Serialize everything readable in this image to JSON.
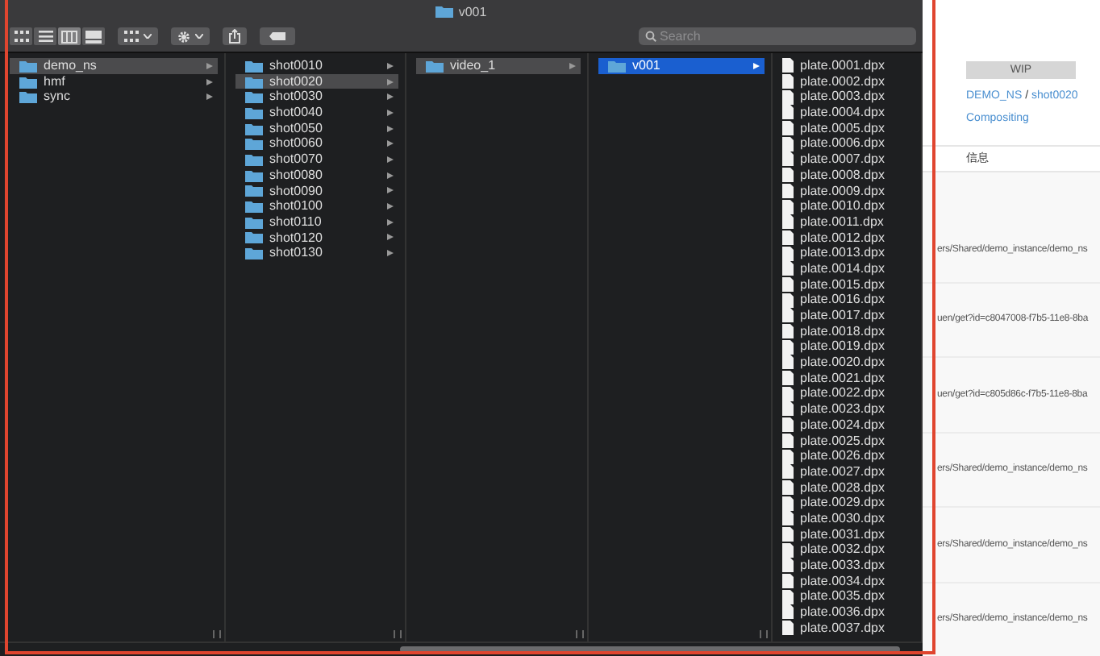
{
  "window": {
    "title": "v001"
  },
  "toolbar": {
    "view_modes": [
      {
        "selected": false
      },
      {
        "selected": false
      },
      {
        "selected": true
      },
      {
        "selected": false
      }
    ],
    "search": {
      "placeholder": "Search"
    }
  },
  "columns": [
    {
      "items": [
        {
          "name": "demo_ns",
          "kind": "folder",
          "selected": true,
          "focused": false
        },
        {
          "name": "hmf",
          "kind": "folder",
          "selected": false,
          "focused": false
        },
        {
          "name": "sync",
          "kind": "folder",
          "selected": false,
          "focused": false
        }
      ]
    },
    {
      "items": [
        {
          "name": "shot0010",
          "kind": "folder",
          "selected": false,
          "focused": false
        },
        {
          "name": "shot0020",
          "kind": "folder",
          "selected": true,
          "focused": false
        },
        {
          "name": "shot0030",
          "kind": "folder",
          "selected": false,
          "focused": false
        },
        {
          "name": "shot0040",
          "kind": "folder",
          "selected": false,
          "focused": false
        },
        {
          "name": "shot0050",
          "kind": "folder",
          "selected": false,
          "focused": false
        },
        {
          "name": "shot0060",
          "kind": "folder",
          "selected": false,
          "focused": false
        },
        {
          "name": "shot0070",
          "kind": "folder",
          "selected": false,
          "focused": false
        },
        {
          "name": "shot0080",
          "kind": "folder",
          "selected": false,
          "focused": false
        },
        {
          "name": "shot0090",
          "kind": "folder",
          "selected": false,
          "focused": false
        },
        {
          "name": "shot0100",
          "kind": "folder",
          "selected": false,
          "focused": false
        },
        {
          "name": "shot0110",
          "kind": "folder",
          "selected": false,
          "focused": false
        },
        {
          "name": "shot0120",
          "kind": "folder",
          "selected": false,
          "focused": false
        },
        {
          "name": "shot0130",
          "kind": "folder",
          "selected": false,
          "focused": false
        }
      ]
    },
    {
      "items": [
        {
          "name": "video_1",
          "kind": "folder",
          "selected": true,
          "focused": false
        }
      ]
    },
    {
      "items": [
        {
          "name": "v001",
          "kind": "folder",
          "selected": true,
          "focused": true
        }
      ]
    },
    {
      "items": [
        {
          "name": "plate.0001.dpx",
          "kind": "file",
          "selected": false,
          "focused": false
        },
        {
          "name": "plate.0002.dpx",
          "kind": "file",
          "selected": false,
          "focused": false
        },
        {
          "name": "plate.0003.dpx",
          "kind": "file",
          "selected": false,
          "focused": false
        },
        {
          "name": "plate.0004.dpx",
          "kind": "file",
          "selected": false,
          "focused": false
        },
        {
          "name": "plate.0005.dpx",
          "kind": "file",
          "selected": false,
          "focused": false
        },
        {
          "name": "plate.0006.dpx",
          "kind": "file",
          "selected": false,
          "focused": false
        },
        {
          "name": "plate.0007.dpx",
          "kind": "file",
          "selected": false,
          "focused": false
        },
        {
          "name": "plate.0008.dpx",
          "kind": "file",
          "selected": false,
          "focused": false
        },
        {
          "name": "plate.0009.dpx",
          "kind": "file",
          "selected": false,
          "focused": false
        },
        {
          "name": "plate.0010.dpx",
          "kind": "file",
          "selected": false,
          "focused": false
        },
        {
          "name": "plate.0011.dpx",
          "kind": "file",
          "selected": false,
          "focused": false
        },
        {
          "name": "plate.0012.dpx",
          "kind": "file",
          "selected": false,
          "focused": false
        },
        {
          "name": "plate.0013.dpx",
          "kind": "file",
          "selected": false,
          "focused": false
        },
        {
          "name": "plate.0014.dpx",
          "kind": "file",
          "selected": false,
          "focused": false
        },
        {
          "name": "plate.0015.dpx",
          "kind": "file",
          "selected": false,
          "focused": false
        },
        {
          "name": "plate.0016.dpx",
          "kind": "file",
          "selected": false,
          "focused": false
        },
        {
          "name": "plate.0017.dpx",
          "kind": "file",
          "selected": false,
          "focused": false
        },
        {
          "name": "plate.0018.dpx",
          "kind": "file",
          "selected": false,
          "focused": false
        },
        {
          "name": "plate.0019.dpx",
          "kind": "file",
          "selected": false,
          "focused": false
        },
        {
          "name": "plate.0020.dpx",
          "kind": "file",
          "selected": false,
          "focused": false
        },
        {
          "name": "plate.0021.dpx",
          "kind": "file",
          "selected": false,
          "focused": false
        },
        {
          "name": "plate.0022.dpx",
          "kind": "file",
          "selected": false,
          "focused": false
        },
        {
          "name": "plate.0023.dpx",
          "kind": "file",
          "selected": false,
          "focused": false
        },
        {
          "name": "plate.0024.dpx",
          "kind": "file",
          "selected": false,
          "focused": false
        },
        {
          "name": "plate.0025.dpx",
          "kind": "file",
          "selected": false,
          "focused": false
        },
        {
          "name": "plate.0026.dpx",
          "kind": "file",
          "selected": false,
          "focused": false
        },
        {
          "name": "plate.0027.dpx",
          "kind": "file",
          "selected": false,
          "focused": false
        },
        {
          "name": "plate.0028.dpx",
          "kind": "file",
          "selected": false,
          "focused": false
        },
        {
          "name": "plate.0029.dpx",
          "kind": "file",
          "selected": false,
          "focused": false
        },
        {
          "name": "plate.0030.dpx",
          "kind": "file",
          "selected": false,
          "focused": false
        },
        {
          "name": "plate.0031.dpx",
          "kind": "file",
          "selected": false,
          "focused": false
        },
        {
          "name": "plate.0032.dpx",
          "kind": "file",
          "selected": false,
          "focused": false
        },
        {
          "name": "plate.0033.dpx",
          "kind": "file",
          "selected": false,
          "focused": false
        },
        {
          "name": "plate.0034.dpx",
          "kind": "file",
          "selected": false,
          "focused": false
        },
        {
          "name": "plate.0035.dpx",
          "kind": "file",
          "selected": false,
          "focused": false
        },
        {
          "name": "plate.0036.dpx",
          "kind": "file",
          "selected": false,
          "focused": false
        },
        {
          "name": "plate.0037.dpx",
          "kind": "file",
          "selected": false,
          "focused": false
        }
      ]
    }
  ],
  "background_page": {
    "status": "WIP",
    "project": "DEMO_NS",
    "separator": "/",
    "shot": "shot0020",
    "task": "Compositing",
    "tabs": [
      "信息"
    ],
    "rows": [
      "ers/Shared/demo_instance/demo_ns",
      "uen/get?id=c8047008-f7b5-11e8-8ba",
      "uen/get?id=c805d86c-f7b5-11e8-8ba",
      "ers/Shared/demo_instance/demo_ns",
      "ers/Shared/demo_instance/demo_ns",
      "ers/Shared/demo_instance/demo_ns"
    ]
  }
}
